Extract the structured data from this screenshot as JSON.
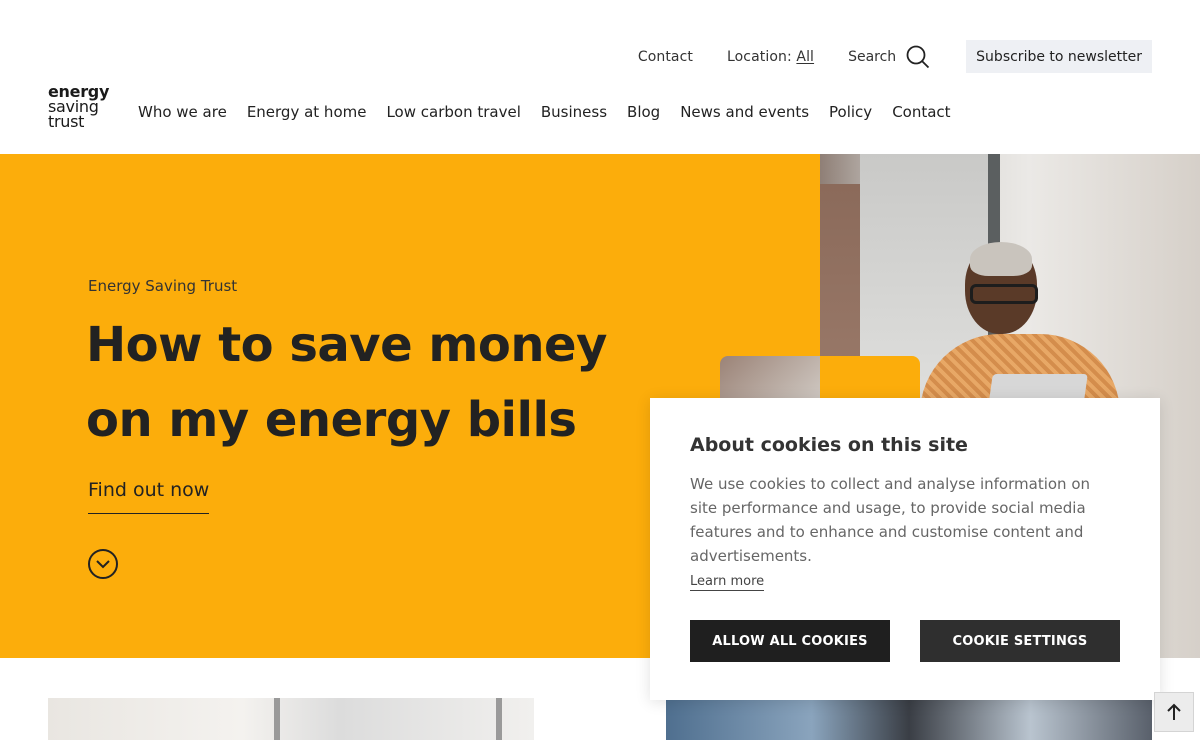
{
  "utility_nav": {
    "contact": "Contact",
    "location_label": "Location:",
    "location_value": "All",
    "search": "Search",
    "subscribe": "Subscribe to newsletter"
  },
  "logo": {
    "line1": "energy",
    "line2": "saving",
    "line3": "trust"
  },
  "main_nav": [
    "Who we are",
    "Energy at home",
    "Low carbon travel",
    "Business",
    "Blog",
    "News and events",
    "Policy",
    "Contact"
  ],
  "hero": {
    "eyebrow": "Energy Saving Trust",
    "title_line1": "How to save money",
    "title_line2": "on my energy bills",
    "cta": "Find out now"
  },
  "cookie": {
    "title": "About cookies on this site",
    "body": "We use cookies to collect and analyse information on site performance and usage, to provide social media features and to enhance and customise content and advertisements.",
    "learn_more": "Learn more",
    "allow": "ALLOW ALL COOKIES",
    "settings": "COOKIE SETTINGS"
  },
  "colors": {
    "brand_yellow": "#fcad0b",
    "dark": "#222222",
    "subscribe_bg": "#eef0f4"
  },
  "icons": {
    "search": "search-icon",
    "scroll_down": "chevron-down-icon",
    "back_to_top": "arrow-up-icon"
  }
}
